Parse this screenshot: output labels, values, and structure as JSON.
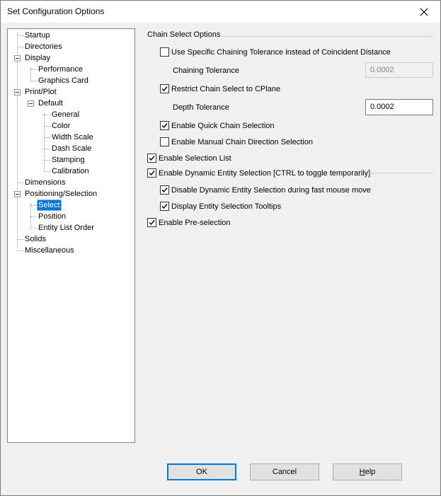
{
  "window": {
    "title": "Set Configuration Options"
  },
  "tree": [
    {
      "label": "Startup"
    },
    {
      "label": "Directories"
    },
    {
      "label": "Display"
    },
    {
      "label": "Performance"
    },
    {
      "label": "Graphics Card"
    },
    {
      "label": "Print/Plot"
    },
    {
      "label": "Default"
    },
    {
      "label": "General"
    },
    {
      "label": "Color"
    },
    {
      "label": "Width Scale"
    },
    {
      "label": "Dash Scale"
    },
    {
      "label": "Stamping"
    },
    {
      "label": "Calibration"
    },
    {
      "label": "Dimensions"
    },
    {
      "label": "Positioning/Selection"
    },
    {
      "label": "Select",
      "selected": true
    },
    {
      "label": "Position"
    },
    {
      "label": "Entity List Order"
    },
    {
      "label": "Solids"
    },
    {
      "label": "Miscellaneous"
    }
  ],
  "panel": {
    "group_title": "Chain Select Options",
    "use_specific_tolerance": {
      "label": "Use Specific Chaining Tolerance instead of Coincident Distance",
      "checked": false
    },
    "chaining_tolerance": {
      "label": "Chaining Tolerance",
      "value": "0.0002",
      "enabled": false
    },
    "restrict_cplane": {
      "label": "Restrict Chain Select to CPlane",
      "checked": true
    },
    "depth_tolerance": {
      "label": "Depth Tolerance",
      "value": "0.0002",
      "enabled": true
    },
    "quick_chain": {
      "label": "Enable Quick Chain Selection",
      "checked": true
    },
    "manual_direction": {
      "label": "Enable Manual Chain Direction Selection",
      "checked": false
    },
    "selection_list": {
      "label": "Enable Selection List",
      "checked": true
    },
    "dynamic_selection": {
      "label": "Enable Dynamic Entity Selection [CTRL to toggle temporarily]",
      "checked": true
    },
    "disable_fast_mouse": {
      "label": "Disable Dynamic Entity Selection during fast mouse move",
      "checked": true
    },
    "tooltips": {
      "label": "Display Entity Selection Tooltips",
      "checked": true
    },
    "preselection": {
      "label": "Enable Pre-selection",
      "checked": true
    }
  },
  "buttons": {
    "ok": "OK",
    "cancel": "Cancel",
    "help_mnemonic": "H",
    "help_rest": "elp"
  },
  "icons": {
    "close": "close-icon",
    "check": "checkmark-icon",
    "expand": "minus-expander-icon"
  },
  "colors": {
    "selection": "#0078d7",
    "background": "#f0f0f0"
  }
}
